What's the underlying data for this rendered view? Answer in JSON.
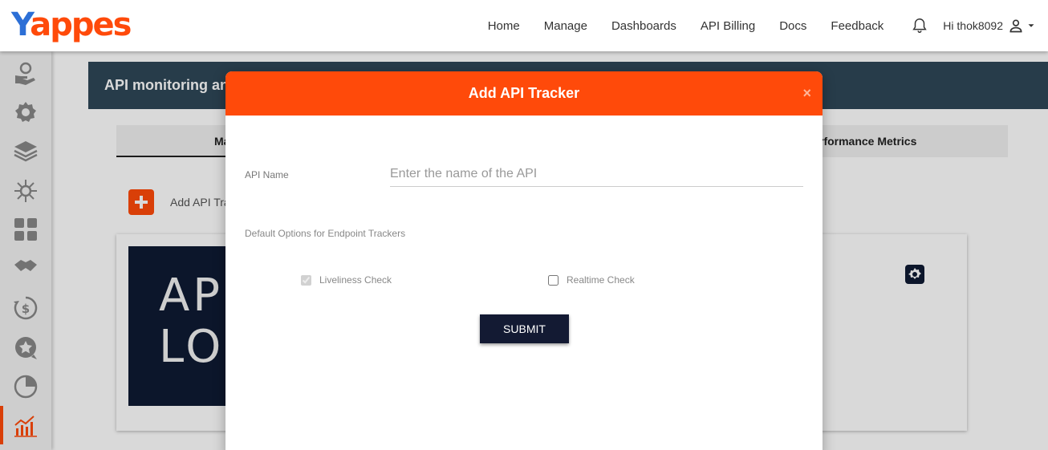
{
  "header": {
    "logo": {
      "first": "Y",
      "rest": "appes"
    },
    "nav": [
      "Home",
      "Manage",
      "Dashboards",
      "API Billing",
      "Docs",
      "Feedback"
    ],
    "user_greeting": "Hi thok8092"
  },
  "sidebar": {
    "items": [
      {
        "icon": "hand-holding-user-icon"
      },
      {
        "icon": "gear-icon"
      },
      {
        "icon": "layers-icon"
      },
      {
        "icon": "network-hub-icon"
      },
      {
        "icon": "dashboard-grid-icon"
      },
      {
        "icon": "handshake-icon"
      },
      {
        "icon": "dollar-refresh-icon"
      },
      {
        "icon": "star-review-icon"
      },
      {
        "icon": "pie-chart-icon"
      },
      {
        "icon": "bar-chart-icon",
        "active": true
      }
    ]
  },
  "main": {
    "banner_title": "API monitoring and",
    "tabs": [
      "Ma",
      "rformance Metrics"
    ],
    "add_label": "Add API Tra",
    "card_image_text": [
      "AP",
      "LO"
    ]
  },
  "modal": {
    "title": "Add API Tracker",
    "close": "×",
    "api_name_label": "API Name",
    "api_name_placeholder": "Enter the name of the API",
    "api_name_value": "",
    "defaults_label": "Default Options for Endpoint Trackers",
    "liveliness_label": "Liveliness Check",
    "liveliness_checked": true,
    "liveliness_disabled": true,
    "realtime_label": "Realtime Check",
    "realtime_checked": false,
    "submit_label": "SUBMIT"
  },
  "colors": {
    "accent": "#ff4a0a",
    "banner": "#2e4757",
    "submit": "#131a33",
    "logo_blue": "#2c6fd6"
  }
}
